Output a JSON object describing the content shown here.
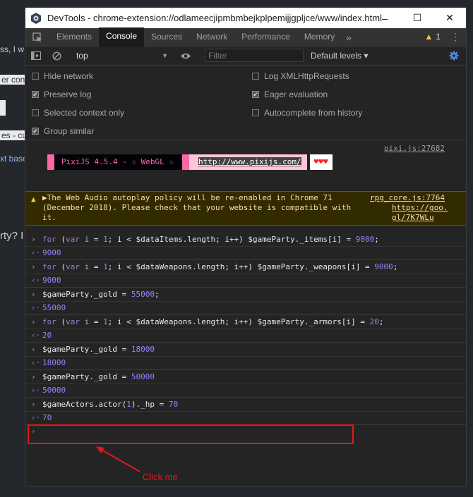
{
  "background": {
    "fragments": [
      "ss, I w",
      "er con",
      "es - cu",
      "xt base",
      "rty? I"
    ]
  },
  "window": {
    "title": "DevTools - chrome-extension://odlameecjipmbmbejkplpemijjgpljce/www/index.html",
    "controls": {
      "minimize": "–",
      "maximize": "☐",
      "close": "✕"
    }
  },
  "tabs": [
    {
      "label": "Elements",
      "active": false
    },
    {
      "label": "Console",
      "active": true
    },
    {
      "label": "Sources",
      "active": false
    },
    {
      "label": "Network",
      "active": false
    },
    {
      "label": "Performance",
      "active": false
    },
    {
      "label": "Memory",
      "active": false
    }
  ],
  "tabbar": {
    "more": "»",
    "warning_count": "1",
    "kebab": "⋮"
  },
  "toolbar": {
    "context": "top",
    "filter_placeholder": "Filter",
    "levels": "Default levels ▾"
  },
  "settings": {
    "left": [
      {
        "label": "Hide network",
        "checked": false
      },
      {
        "label": "Preserve log",
        "checked": true
      },
      {
        "label": "Selected context only",
        "checked": false
      },
      {
        "label": "Group similar",
        "checked": true
      }
    ],
    "right": [
      {
        "label": "Log XMLHttpRequests",
        "checked": false
      },
      {
        "label": "Eager evaluation",
        "checked": true
      },
      {
        "label": "Autocomplete from history",
        "checked": false
      }
    ]
  },
  "console": {
    "pixi": {
      "source": "pixi.js:27682",
      "banner_text": "PixiJS 4.5.4 - ☆ WebGL ☆",
      "banner_url": "http://www.pixijs.com/",
      "hearts": "♥♥♥"
    },
    "warning": {
      "text": "▶The Web Audio autoplay policy will be re-enabled in Chrome 71 (December 2018). Please check that your website is compatible with it.",
      "source": "rpg_core.js:7764",
      "link": "https://goo.gl/7K7WLu"
    },
    "results": [
      "9000",
      "9000",
      "55000",
      "20",
      "18000",
      "50000",
      "70"
    ],
    "annotation": "Click me"
  },
  "colors": {
    "accent": "#1a73e8",
    "annotation_red": "#e0181b",
    "pixi_pink": "#ff66a5"
  }
}
